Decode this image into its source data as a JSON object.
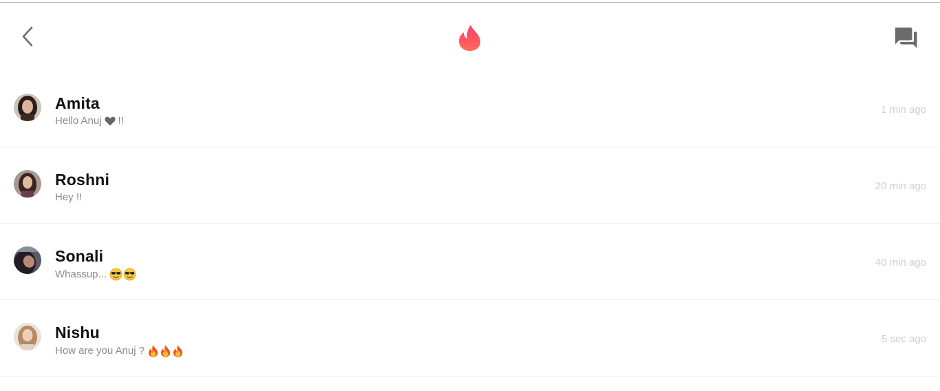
{
  "header": {
    "back_icon": "chevron-left-icon",
    "logo_icon": "flame-icon",
    "chat_icon": "forum-icon",
    "colors": {
      "icon": "#6b6b6b",
      "flame_top": "#fd5068",
      "flame_bottom": "#ff7854"
    }
  },
  "conversations": [
    {
      "name": "Amita",
      "message": "Hello Anuj",
      "message_suffix": "!!",
      "emoji": [
        "heart-icon"
      ],
      "time": "1 min ago"
    },
    {
      "name": "Roshni",
      "message": "Hey !!",
      "message_suffix": "",
      "emoji": [],
      "time": "20 min ago"
    },
    {
      "name": "Sonali",
      "message": "Whassup...",
      "message_suffix": "",
      "emoji": [
        "sunglasses-face-icon",
        "sunglasses-face-icon"
      ],
      "time": "40 min ago"
    },
    {
      "name": "Nishu",
      "message": "How are you Anuj ?",
      "message_suffix": "",
      "emoji": [
        "fire-icon",
        "fire-icon",
        "fire-icon"
      ],
      "time": "5 sec ago"
    }
  ]
}
